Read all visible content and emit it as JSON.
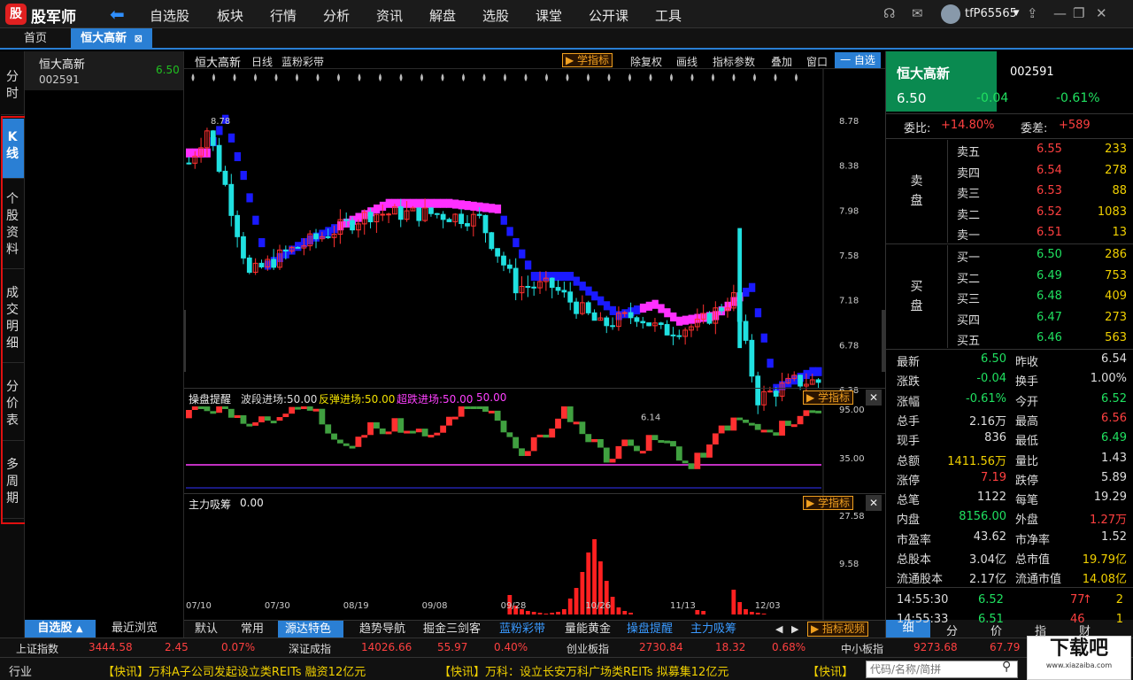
{
  "app": {
    "logo_glyph": "股",
    "name": "股军师",
    "back_glyph": "⬅"
  },
  "menu": [
    "自选股",
    "板块",
    "行情",
    "分析",
    "资讯",
    "解盘",
    "选股",
    "课堂",
    "公开课",
    "工具"
  ],
  "topright": {
    "user": "tfP65565",
    "headset": "☊",
    "mail": "✉",
    "caret": "▾",
    "upload": "⇪",
    "minimize": "—",
    "restore": "❐",
    "close": "✕"
  },
  "tabs": {
    "home": "首页",
    "active": "恒大高新",
    "close": "⊠"
  },
  "left_tabs": [
    [
      "分",
      "时"
    ],
    [
      "K",
      "线"
    ],
    [
      "个",
      "股",
      "资",
      "料"
    ],
    [
      "成",
      "交",
      "明",
      "细"
    ],
    [
      "分",
      "价",
      "表"
    ],
    [
      "多",
      "周",
      "期"
    ]
  ],
  "stock_list": {
    "name": "恒大高新",
    "code": "002591",
    "price": "6.50",
    "tab_self": "自选股",
    "tab_self_arrow": "▲",
    "tab_recent": "最近浏览"
  },
  "chart": {
    "header": {
      "name": "恒大高新",
      "period": "日线",
      "indicator": "蓝粉彩带",
      "learn": "学指标",
      "btns": [
        "除复权",
        "画线",
        "指标参数",
        "叠加",
        "窗口"
      ],
      "self_btn": "一 自选"
    },
    "price_axis": [
      "8.78",
      "8.38",
      "7.98",
      "7.58",
      "7.18",
      "6.78",
      "6.38"
    ],
    "high_label": "8.78",
    "low_label": "6.14",
    "date_axis": [
      "07/10",
      "07/30",
      "08/19",
      "09/08",
      "09/28",
      "10/26",
      "11/13",
      "12/03"
    ],
    "sub1": {
      "title": "操盘提醒",
      "l1": "波段进场:50.00",
      "l2": "反弹进场:50.00",
      "l3": "超跌进场:50.00",
      "l4": "50.00",
      "learn": "学指标",
      "close": "✕",
      "axis": [
        "95.00",
        "35.00"
      ]
    },
    "sub2": {
      "title": "主力吸筹",
      "val": "0.00",
      "learn": "学指标",
      "close": "✕",
      "axis": [
        "27.58",
        "9.58"
      ]
    },
    "colors": {
      "up": "#ff3030",
      "down": "#20e0e0",
      "blue": "#1a1aff",
      "pink": "#ff30ff",
      "green": "#40a040"
    }
  },
  "bottom_tabs": [
    "默认",
    "常用",
    "源达特色",
    "趋势导航",
    "掘金三剑客",
    "蓝粉彩带",
    "量能黄金",
    "操盘提醒",
    "主力吸筹"
  ],
  "bottom_video": "指标视频",
  "bottom_nav": {
    "left": "◀",
    "right": "▶"
  },
  "quote": {
    "name": "恒大高新",
    "code": "002591",
    "price": "6.50",
    "change": "-0.04",
    "pct": "-0.61%",
    "weibi_label": "委比:",
    "weibi": "+14.80%",
    "weicha_label": "委差:",
    "weicha": "+589",
    "sell_label": [
      "卖",
      "盘"
    ],
    "buy_label": [
      "买",
      "盘"
    ],
    "sell": [
      [
        "卖五",
        "6.55",
        "233"
      ],
      [
        "卖四",
        "6.54",
        "278"
      ],
      [
        "卖三",
        "6.53",
        "88"
      ],
      [
        "卖二",
        "6.52",
        "1083"
      ],
      [
        "卖一",
        "6.51",
        "13"
      ]
    ],
    "buy": [
      [
        "买一",
        "6.50",
        "286"
      ],
      [
        "买二",
        "6.49",
        "753"
      ],
      [
        "买三",
        "6.48",
        "409"
      ],
      [
        "买四",
        "6.47",
        "273"
      ],
      [
        "买五",
        "6.46",
        "563"
      ]
    ],
    "stats": [
      [
        "最新",
        "6.50",
        "昨收",
        "6.54"
      ],
      [
        "涨跌",
        "-0.04",
        "换手",
        "1.00%"
      ],
      [
        "涨幅",
        "-0.61%",
        "今开",
        "6.52"
      ],
      [
        "总手",
        "2.16万",
        "最高",
        "6.56"
      ],
      [
        "现手",
        "836",
        "最低",
        "6.49"
      ],
      [
        "总额",
        "1411.56万",
        "量比",
        "1.43"
      ],
      [
        "涨停",
        "7.19",
        "跌停",
        "5.89"
      ],
      [
        "总笔",
        "1122",
        "每笔",
        "19.29"
      ],
      [
        "内盘",
        "8156.00",
        "外盘",
        "1.27万"
      ],
      [
        "市盈率",
        "43.62",
        "市净率",
        "1.52"
      ],
      [
        "总股本",
        "3.04亿",
        "总市值",
        "19.79亿"
      ],
      [
        "流通股本",
        "2.17亿",
        "流通市值",
        "14.08亿"
      ]
    ],
    "ticks": [
      [
        "14:55:30",
        "6.52",
        "77",
        "2"
      ],
      [
        "14:55:33",
        "6.51",
        "46",
        "1"
      ]
    ],
    "tick_up_arrow": "↑",
    "bottom_tabs": [
      "细",
      "分",
      "价",
      "指",
      "财"
    ]
  },
  "index_bar": {
    "items": [
      [
        "上证指数",
        "3444.58",
        "2.45",
        "0.07%"
      ],
      [
        "深证成指",
        "14026.66",
        "55.97",
        "0.40%"
      ],
      [
        "创业板指",
        "2730.84",
        "18.32",
        "0.68%"
      ],
      [
        "中小板指",
        "9273.68",
        "67.79",
        ""
      ]
    ]
  },
  "news_bar": {
    "label": "行业",
    "n1": "【快讯】万科A子公司发起设立类REITs 融资12亿元",
    "n2": "【快讯】万科：设立长安万科广场类REITs 拟募集12亿元",
    "n3": "【快讯】",
    "search_placeholder": "代码/名称/简拼",
    "search_icon": "⚲"
  },
  "watermark": {
    "text": "下载吧",
    "url": "www.xiazaiba.com"
  }
}
